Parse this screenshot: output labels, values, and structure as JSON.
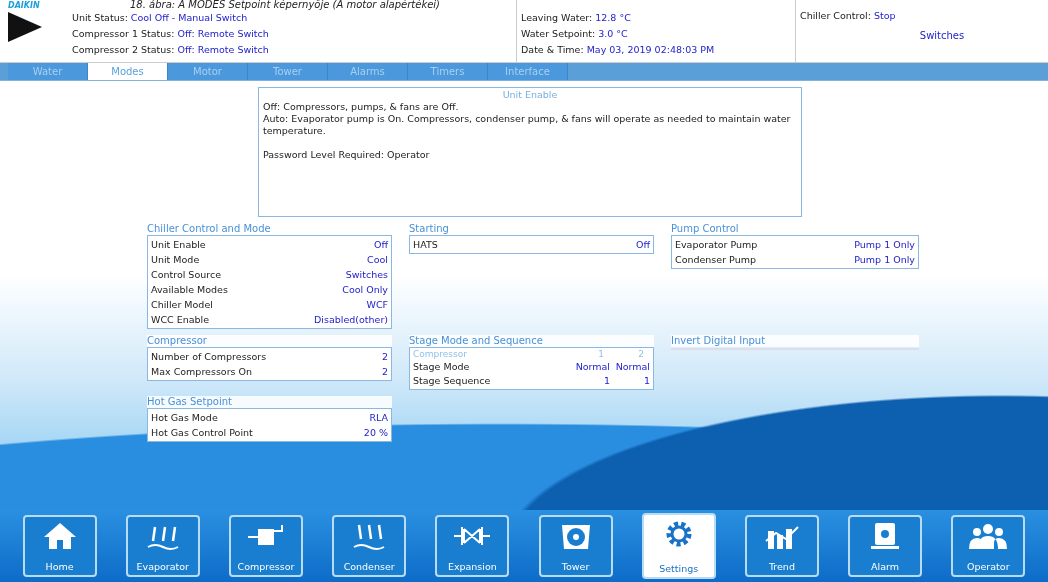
{
  "caption": "18. ábra: A MODES Setpoint képernyője (A motor alapértékei)",
  "header": {
    "logo": "DAIKIN",
    "status": [
      {
        "label": "Unit Status: ",
        "value": "Cool Off - Manual Switch"
      },
      {
        "label": "Compressor 1 Status: ",
        "value": "Off: Remote Switch"
      },
      {
        "label": "Compressor 2 Status: ",
        "value": "Off: Remote Switch"
      }
    ],
    "water": [
      {
        "label": "Leaving Water: ",
        "value": "12.8 °C"
      },
      {
        "label": "Water Setpoint: ",
        "value": "3.0 °C"
      },
      {
        "label": "Date & Time: ",
        "value": "May 03, 2019  02:48:03 PM"
      }
    ],
    "control": {
      "label": "Chiller Control: ",
      "value": "Stop",
      "source": "Switches"
    }
  },
  "tabs": [
    {
      "label": "Water",
      "selected": false
    },
    {
      "label": "Modes",
      "selected": true
    },
    {
      "label": "Motor",
      "selected": false
    },
    {
      "label": "Tower",
      "selected": false
    },
    {
      "label": "Alarms",
      "selected": false
    },
    {
      "label": "Timers",
      "selected": false
    },
    {
      "label": "Interface",
      "selected": false
    }
  ],
  "help": {
    "title": "Unit Enable",
    "paragraphs": [
      [
        "Off: Compressors, pumps, & fans are Off.",
        "Auto:  Evaporator pump is On. Compressors, condenser pump, & fans will operate as needed to maintain water temperature."
      ],
      [
        "Password Level Required: Operator"
      ]
    ]
  },
  "panels": [
    {
      "title": "Chiller Control and Mode",
      "kind": "list",
      "rows": [
        {
          "label": "Unit Enable",
          "value": "Off"
        },
        {
          "label": "Unit Mode",
          "value": "Cool"
        },
        {
          "label": "Control Source",
          "value": "Switches"
        },
        {
          "label": "Available Modes",
          "value": "Cool Only"
        },
        {
          "label": "Chiller Model",
          "value": "WCF"
        },
        {
          "label": "WCC Enable",
          "value": "Disabled(other)"
        }
      ]
    },
    {
      "title": "Starting",
      "kind": "list",
      "rows": [
        {
          "label": "HATS",
          "value": "Off"
        }
      ]
    },
    {
      "title": "Pump Control",
      "kind": "list",
      "rows": [
        {
          "label": "Evaporator Pump",
          "value": "Pump 1 Only"
        },
        {
          "label": "Condenser Pump",
          "value": "Pump 1 Only"
        }
      ]
    },
    {
      "title": "Compressor",
      "kind": "list",
      "rows": [
        {
          "label": "Number of Compressors",
          "value": "2"
        },
        {
          "label": "Max Compressors On",
          "value": "2"
        }
      ]
    },
    {
      "title": "Stage Mode and Sequence",
      "kind": "table",
      "columns": [
        "Compressor",
        "1",
        "2"
      ],
      "rows": [
        {
          "label": "Stage Mode",
          "values": [
            "Normal",
            "Normal"
          ]
        },
        {
          "label": "Stage Sequence",
          "values": [
            "1",
            "1"
          ]
        }
      ]
    },
    {
      "title": "Invert Digital Input",
      "kind": "empty"
    },
    {
      "title": "Hot Gas Setpoint",
      "kind": "list",
      "rows": [
        {
          "label": "Hot Gas Mode",
          "value": "RLA"
        },
        {
          "label": "Hot Gas Control Point",
          "value": "20 %"
        }
      ]
    }
  ],
  "nav": [
    {
      "label": "Home",
      "selected": false
    },
    {
      "label": "Evaporator",
      "selected": false
    },
    {
      "label": "Compressor",
      "selected": false
    },
    {
      "label": "Condenser",
      "selected": false
    },
    {
      "label": "Expansion",
      "selected": false
    },
    {
      "label": "Tower",
      "selected": false
    },
    {
      "label": "Settings",
      "selected": true
    },
    {
      "label": "Trend",
      "selected": false
    },
    {
      "label": "Alarm",
      "selected": false
    },
    {
      "label": "Operator",
      "selected": false
    }
  ]
}
